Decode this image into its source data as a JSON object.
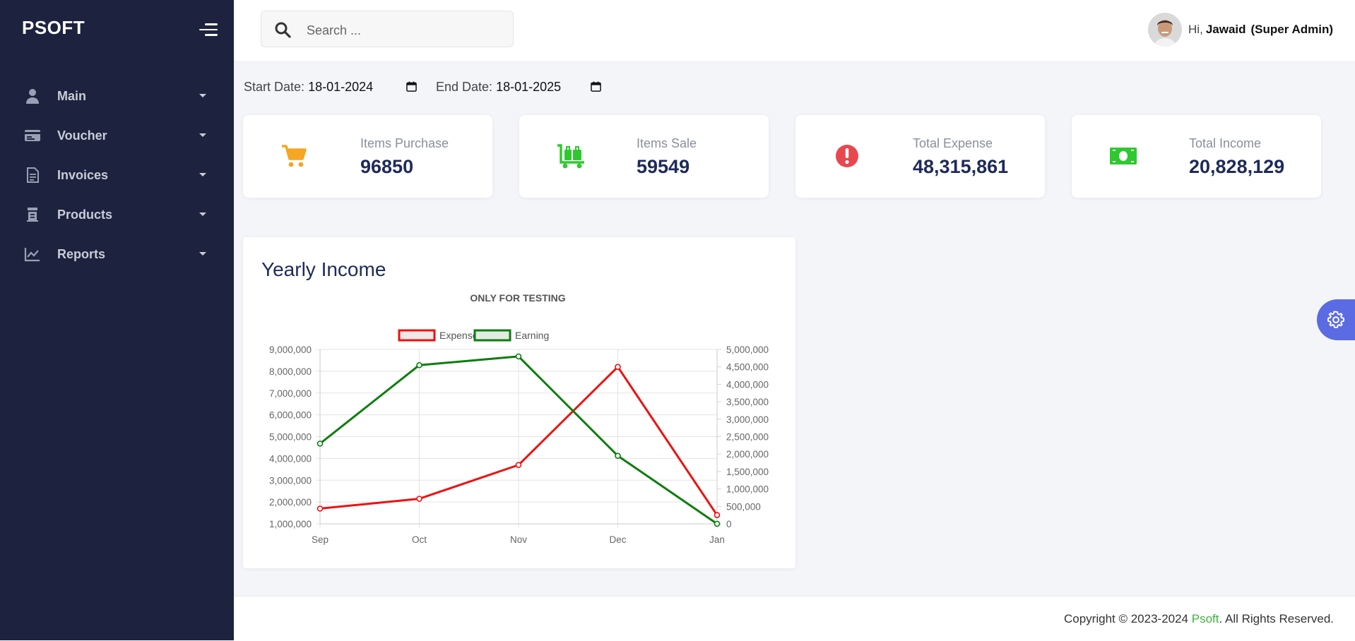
{
  "sidebar": {
    "brand": "PSOFT",
    "items": [
      {
        "label": "Main",
        "icon": "user-icon"
      },
      {
        "label": "Voucher",
        "icon": "voucher-card-icon"
      },
      {
        "label": "Invoices",
        "icon": "document-icon"
      },
      {
        "label": "Products",
        "icon": "products-stack-icon"
      },
      {
        "label": "Reports",
        "icon": "chart-line-icon"
      }
    ]
  },
  "header": {
    "search_placeholder": "Search ...",
    "greeting": "Hi,",
    "user_name": "Jawaid",
    "role": "(Super Admin)"
  },
  "filters": {
    "start_label": "Start Date:",
    "start_value": "18-01-2024",
    "end_label": "End Date:",
    "end_value": "18-01-2025"
  },
  "stats": [
    {
      "title": "Items Purchase",
      "value": "96850",
      "icon": "cart-icon",
      "color": "#f5a623"
    },
    {
      "title": "Items Sale",
      "value": "59549",
      "icon": "luggage-cart-icon",
      "color": "#2ec92e"
    },
    {
      "title": "Total Expense",
      "value": "48,315,861",
      "icon": "exclamation-circle-icon",
      "color": "#e9474f"
    },
    {
      "title": "Total Income",
      "value": "20,828,129",
      "icon": "money-bill-icon",
      "color": "#2ec92e"
    }
  ],
  "yearly_income": {
    "card_title": "Yearly Income"
  },
  "chart_data": {
    "type": "line",
    "title": "ONLY FOR TESTING",
    "categories": [
      "Sep",
      "Oct",
      "Nov",
      "Dec",
      "Jan"
    ],
    "y_left": {
      "min": 1000000,
      "max": 9000000,
      "step": 1000000,
      "ticks": [
        "9,000,000",
        "8,000,000",
        "7,000,000",
        "6,000,000",
        "5,000,000",
        "4,000,000",
        "3,000,000",
        "2,000,000",
        "1,000,000"
      ]
    },
    "y_right": {
      "min": 0,
      "max": 5000000,
      "step": 500000,
      "ticks": [
        "5,000,000",
        "4,500,000",
        "4,000,000",
        "3,500,000",
        "3,000,000",
        "2,500,000",
        "2,000,000",
        "1,500,000",
        "1,000,000",
        "500,000",
        "0"
      ]
    },
    "legend_position": "top",
    "grid": true,
    "series": [
      {
        "name": "Expense",
        "axis": "left",
        "color": "#ee1111",
        "values": [
          1700000,
          2150000,
          3700000,
          8200000,
          1400000
        ]
      },
      {
        "name": "Earning",
        "axis": "right",
        "color": "#0d7d0d",
        "values": [
          2300000,
          4550000,
          4800000,
          1950000,
          0
        ]
      }
    ]
  },
  "footer": {
    "prefix": "Copyright © 2023-2024 ",
    "brand": "Psoft",
    "suffix": ". All Rights Reserved."
  }
}
